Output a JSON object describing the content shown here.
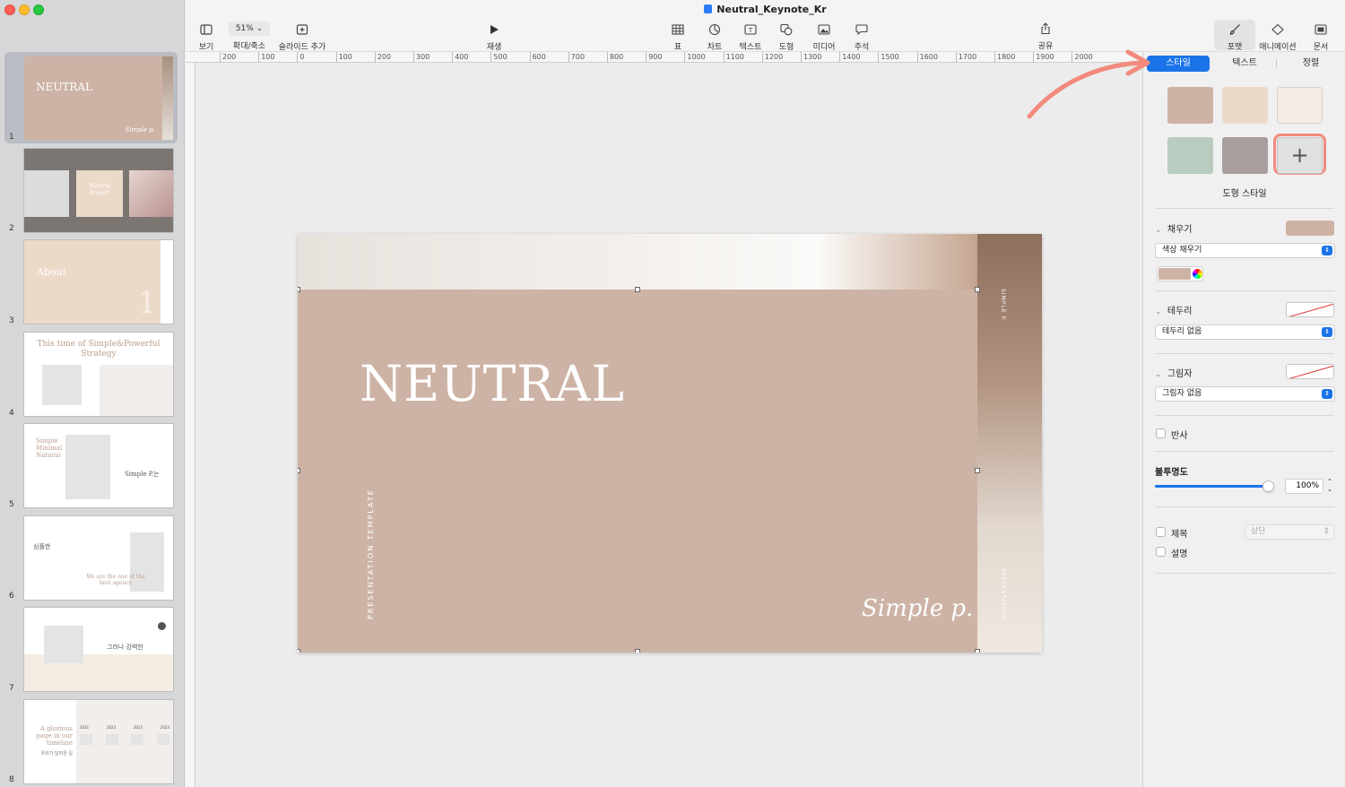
{
  "window": {
    "title": "Neutral_Keynote_Kr"
  },
  "toolbar": {
    "view_label": "보기",
    "zoom_value": "51%",
    "zoom_label": "확대/축소",
    "add_slide_label": "슬라이드 추가",
    "play_label": "재생",
    "table_label": "표",
    "chart_label": "차트",
    "text_label": "텍스트",
    "shape_label": "도형",
    "media_label": "미디어",
    "comment_label": "주석",
    "share_label": "공유",
    "format_label": "포맷",
    "animate_label": "애니메이션",
    "document_label": "문서"
  },
  "ruler": {
    "labels": [
      "200",
      "100",
      "0",
      "100",
      "200",
      "300",
      "400",
      "500",
      "600",
      "700",
      "800",
      "900",
      "1000",
      "1100",
      "1200",
      "1300",
      "1400",
      "1500",
      "1600",
      "1700",
      "1800",
      "1900",
      "2000"
    ]
  },
  "slides": [
    {
      "number": "1",
      "title": "NEUTRAL"
    },
    {
      "number": "2",
      "title": "Neutral Project"
    },
    {
      "number": "3",
      "title": "About",
      "big": "1"
    },
    {
      "number": "4",
      "title": "This time of Simple&Powerful Strategy"
    },
    {
      "number": "5",
      "title": "Simple Minimal Natural",
      "side": "Simple P.는"
    },
    {
      "number": "6",
      "title": "심플한",
      "sub": "We are the one of the best agency"
    },
    {
      "number": "7",
      "title": "그러나 강력한"
    },
    {
      "number": "8",
      "title": "A glorious page in our timeline",
      "sub": "우리가 달려온 길",
      "years": [
        "2021",
        "2022",
        "2023",
        "2024"
      ]
    }
  ],
  "main_slide": {
    "title": "NEUTRAL",
    "vertical_text": "PRESENTATION TEMPLATE",
    "signature": "Simple p.",
    "side_top": "SIMPLE P.",
    "side_bottom": "PRESENTATION"
  },
  "inspector": {
    "tabs": [
      "스타일",
      "텍스트",
      "정렬"
    ],
    "active_tab": "스타일",
    "swatch_colors": [
      "#cdb3a5",
      "#ecdac9",
      "#f4ebe6",
      "#b9ccc0",
      "#a89e9d"
    ],
    "shape_style_label": "도형 스타일",
    "fill_label": "채우기",
    "fill_type": "색상 채우기",
    "fill_color": "#cdb3a5",
    "border_label": "테두리",
    "border_type": "테두리 없음",
    "shadow_label": "그림자",
    "shadow_type": "그림자 없음",
    "reflection_label": "반사",
    "opacity_label": "불투명도",
    "opacity_value": "100%",
    "opacity_level": 1.0,
    "title_label": "제목",
    "title_position": "상단",
    "caption_label": "설명"
  },
  "annotation_color": "#f28b7d"
}
